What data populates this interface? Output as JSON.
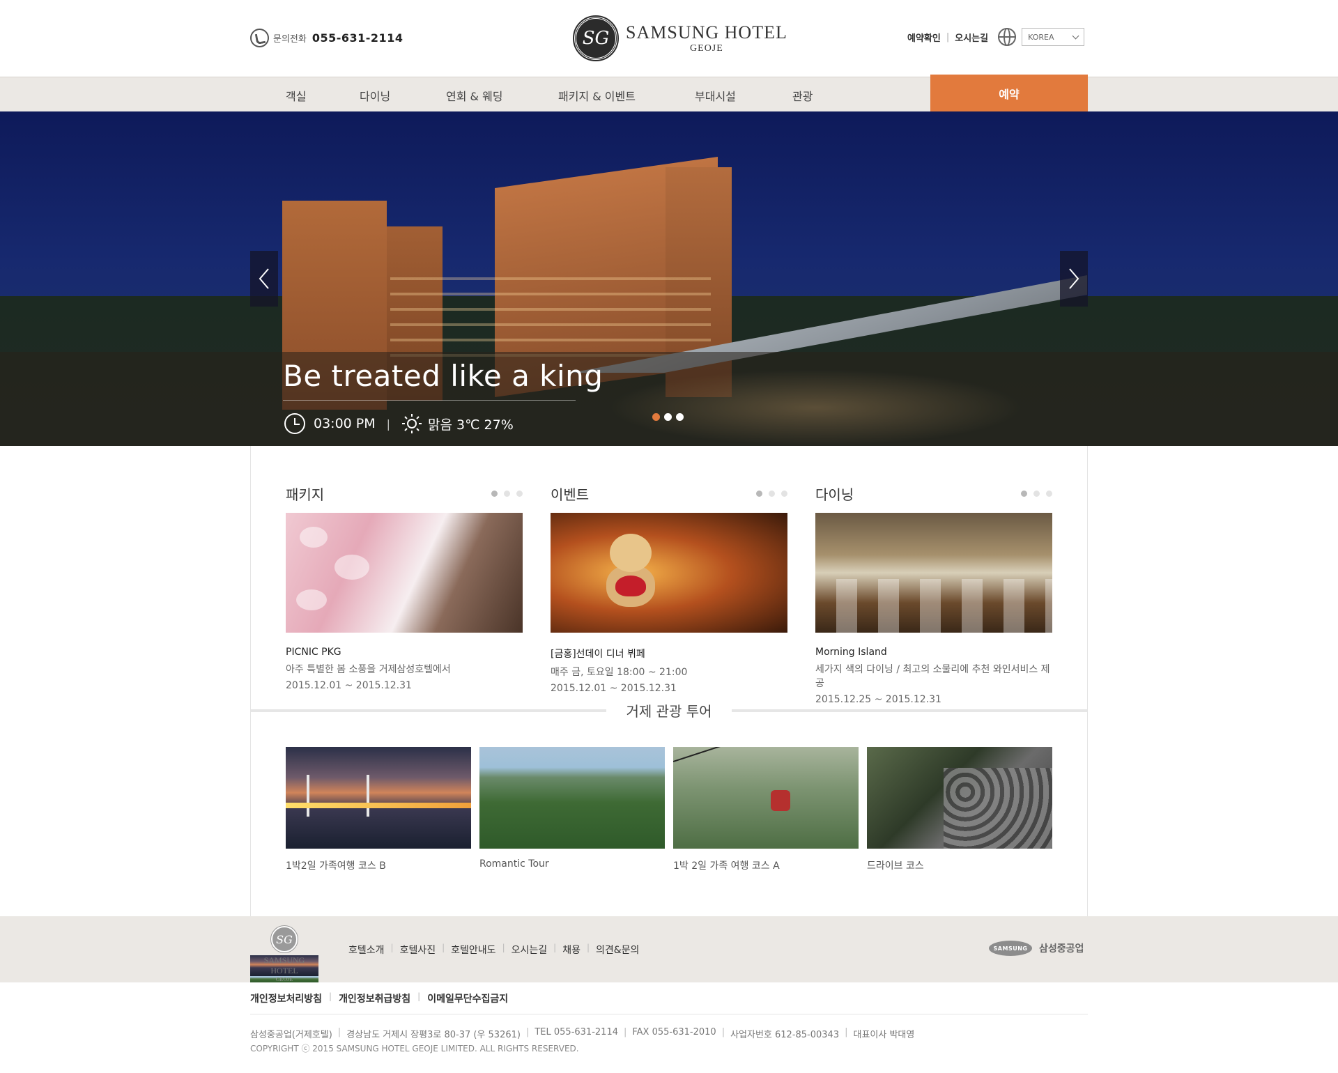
{
  "header": {
    "phone_label": "문의전화",
    "phone_number": "055-631-2114",
    "logo_emblem": "SG",
    "logo_title": "SAMSUNG HOTEL",
    "logo_subtitle": "GEOJE",
    "reservation_check": "예약확인",
    "directions": "오시는길",
    "language": "KOREA"
  },
  "nav": {
    "items": [
      "객실",
      "다이닝",
      "연회 & 웨딩",
      "패키지 & 이벤트",
      "부대시설",
      "관광"
    ],
    "reserve": "예약",
    "reserve_color": "#e27a3d"
  },
  "hero": {
    "title": "Be treated like a king",
    "time": "03:00 PM",
    "weather": "맑음  3℃  27%",
    "prev_icon": "chevron-left-icon",
    "next_icon": "chevron-right-icon",
    "slide_count": 3,
    "active_slide": 1
  },
  "cards": [
    {
      "title": "패키지",
      "name": "PICNIC PKG",
      "desc": "아주 특별한 봄 소풍을 거제삼성호텔에서",
      "date": "2015.12.01 ~ 2015.12.31"
    },
    {
      "title": "이벤트",
      "name": "[금홍]선데이 디너 뷔페",
      "desc": "매주 금, 토요일 18:00 ~ 21:00",
      "date": "2015.12.01 ~ 2015.12.31"
    },
    {
      "title": "다이닝",
      "name": "Morning Island",
      "desc": "세가지 색의 다이닝 / 최고의 소물리에 추천 와인서비스 제공",
      "date": "2015.12.25 ~ 2015.12.31"
    }
  ],
  "tour": {
    "title": "거제 관광 투어",
    "items": [
      "1박2일 가족여행 코스 B",
      "Romantic Tour",
      "1박 2일 가족 여행 코스 A",
      "드라이브 코스"
    ]
  },
  "footer": {
    "logo_emblem": "SG",
    "logo_title": "SAMSUNG HOTEL",
    "logo_subtitle": "GEOJE",
    "menu": [
      "호텔소개",
      "호텔사진",
      "호텔안내도",
      "오시는길",
      "채용",
      "의견&문의"
    ],
    "samsung_logo": "SAMSUNG",
    "company": "삼성중공업",
    "policy": [
      "개인정보처리방침",
      "개인정보취급방침",
      "이메일무단수집금지"
    ],
    "address": [
      "삼성중공업(거제호텔)",
      "경상남도 거제시 장평3로 80-37 (우 53261)",
      "TEL 055-631-2114",
      "FAX 055-631-2010",
      "사업자번호 612-85-00343",
      "대표이사 박대영"
    ],
    "copyright": "COPYRIGHT ⓒ 2015 SAMSUNG HOTEL GEOJE LIMITED. ALL RIGHTS RESERVED."
  }
}
